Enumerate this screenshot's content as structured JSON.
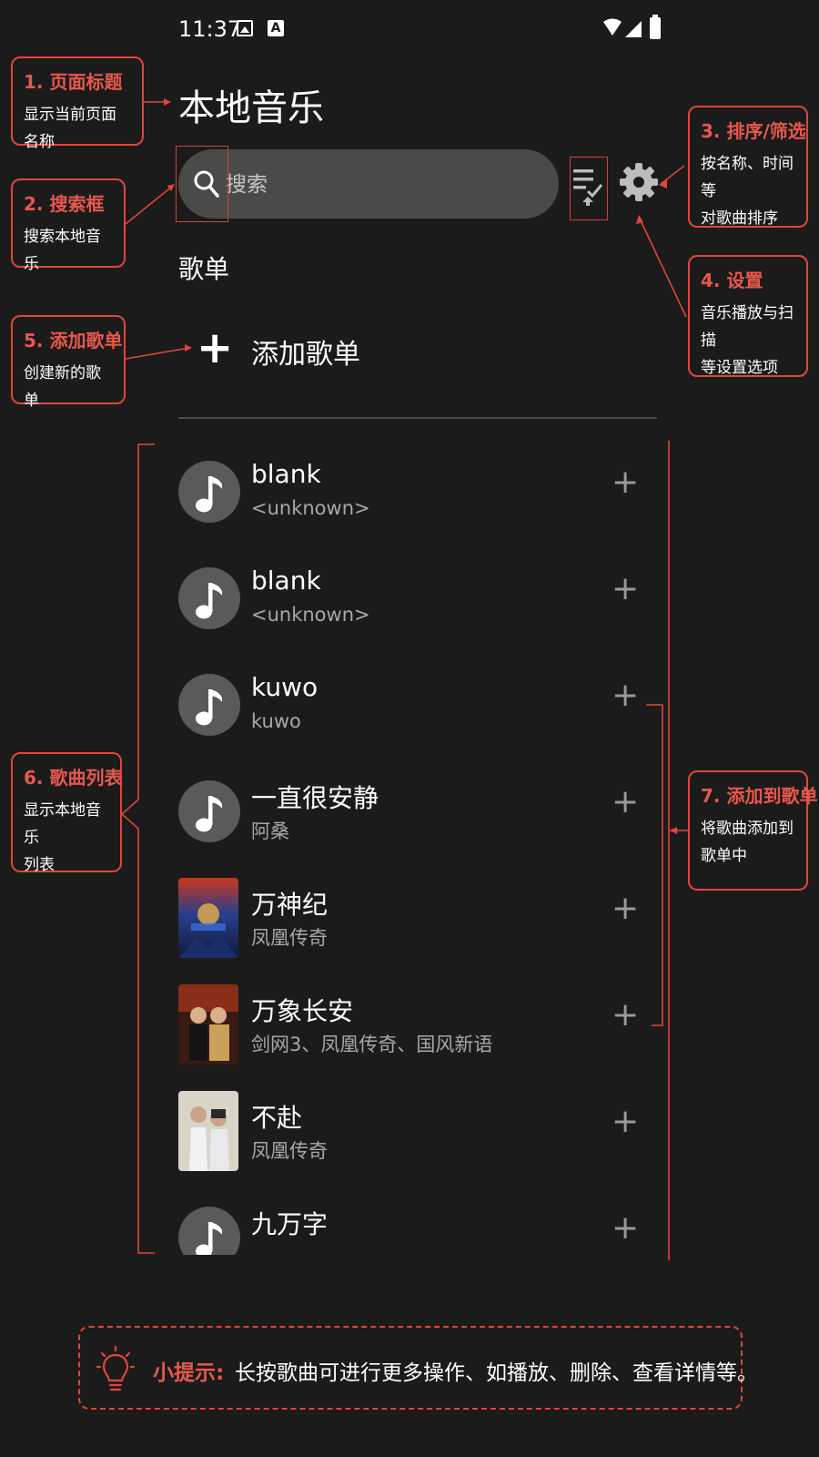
{
  "status_bar": {
    "time": "11:37",
    "icons": [
      "image-icon",
      "a-icon",
      "wifi-icon",
      "signal-icon",
      "battery-icon"
    ]
  },
  "header": {
    "title": "本地音乐"
  },
  "search": {
    "placeholder": "搜索"
  },
  "toolbar": {
    "sort_icon": "sort-filter-icon",
    "settings_icon": "gear-icon"
  },
  "playlist_section": {
    "label": "歌单",
    "add_label": "添加歌单"
  },
  "songs": [
    {
      "title": "blank",
      "artist": "<unknown>",
      "thumb": "note"
    },
    {
      "title": "blank",
      "artist": "<unknown>",
      "thumb": "note"
    },
    {
      "title": "kuwo",
      "artist": "kuwo",
      "thumb": "note"
    },
    {
      "title": "一直很安静",
      "artist": "阿桑",
      "thumb": "note"
    },
    {
      "title": "万神纪",
      "artist": "凤凰传奇",
      "thumb": "cover"
    },
    {
      "title": "万象长安",
      "artist": "剑网3、凤凰传奇、国风新语",
      "thumb": "cover"
    },
    {
      "title": "不赴",
      "artist": "凤凰传奇",
      "thumb": "cover"
    },
    {
      "title": "九万字",
      "artist": "",
      "thumb": "note"
    }
  ],
  "annotations": {
    "a1": {
      "num": "1.",
      "title": "页面标题",
      "desc": "显示当前页面名称"
    },
    "a2": {
      "num": "2.",
      "title": "搜索框",
      "desc": "搜索本地音乐"
    },
    "a3": {
      "num": "3.",
      "title": "排序/筛选",
      "desc1": "按名称、时间等",
      "desc2": "对歌曲排序"
    },
    "a4": {
      "num": "4.",
      "title": "设置",
      "desc1": "音乐播放与扫描",
      "desc2": "等设置选项"
    },
    "a5": {
      "num": "5.",
      "title": "添加歌单",
      "desc": "创建新的歌单"
    },
    "a6": {
      "num": "6.",
      "title": "歌曲列表",
      "desc1": "显示本地音乐",
      "desc2": "列表"
    },
    "a7": {
      "num": "7.",
      "title": "添加到歌单",
      "desc1": "将歌曲添加到",
      "desc2": "歌单中"
    }
  },
  "hint": {
    "label": "小提示:",
    "text": "长按歌曲可进行更多操作、如播放、删除、查看详情等。"
  },
  "colors": {
    "background": "#1b1b1b",
    "accent": "#e0463a",
    "search_bg": "#4a4a4a",
    "secondary_text": "#a8a8a8"
  }
}
